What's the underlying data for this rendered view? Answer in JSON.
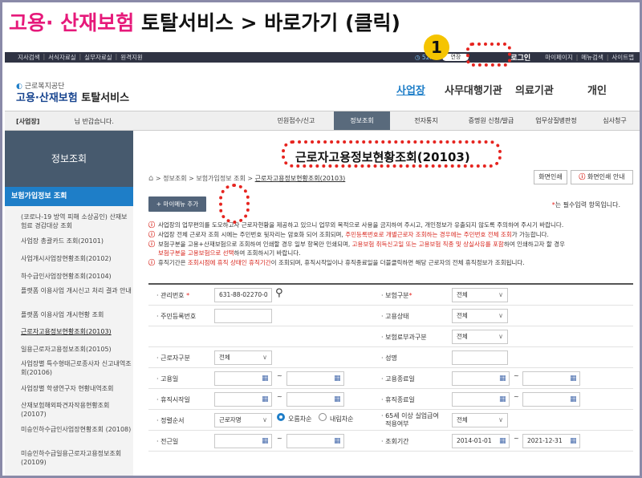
{
  "banner": {
    "part1": "고용·",
    "part2": "산재보험",
    "part3": "토탈서비스 > 바로가기 (클릭)"
  },
  "badge": "1",
  "topbar": {
    "left": [
      "지사검색",
      "서식자료실",
      "실무자료실",
      "원격지원"
    ],
    "timer": "◷ 52:10",
    "ext": "연장",
    "login": "로그인",
    "right": [
      "마이페이지",
      "메뉴검색",
      "사이트맵"
    ]
  },
  "header": {
    "org": "근로복지공단",
    "logo_a": "고용·산재보험",
    "logo_b": "토탈서비스",
    "nav": [
      "사업장",
      "사무대행기관",
      "의료기관",
      "개인"
    ]
  },
  "gnb": {
    "welcome_a": "[사업장]",
    "welcome_b": "님 반갑습니다.",
    "tabs": [
      "민원접수/신고",
      "정보조회",
      "전자통지",
      "증명원 신청/발급",
      "업무상질병판정",
      "심사청구"
    ]
  },
  "sidebar": {
    "title": "정보조회",
    "section": "보험가입정보 조회",
    "items": [
      "(코로나-19 방역 피해 소상공인) 산재보험료 경감대상 조회",
      "사업장 총괄카드 조회(20101)",
      "사업개시사업장현황조회(20102)",
      "하수급인사업장현황조회(20104)",
      "플랫폼 이용사업 개시신고 처리 결과 안내",
      "플랫폼 이용사업 개시현황 조회",
      "근로자고용정보현황조회(20103)",
      "일용근로자고용정보조회(20105)",
      "사업장별 특수형태근로종사자 신고내역조회(20106)",
      "사업장별 학생연구자 현황내역조회",
      "산재보험해외파견자작용현황조회 (20107)",
      "미승인하수급인사업장현황조회 (20108)",
      "미승인하수급일용근로자고용정보조회 (20109)"
    ]
  },
  "main": {
    "title": "근로자고용정보현황조회(20103)",
    "crumb": [
      "정보조회",
      "보험가입정보 조회",
      "근로자고용정보현황조회(20103)"
    ],
    "btn_print": "화면인쇄",
    "btn_guide": "화면인쇄 안내",
    "btn_add": "+ 마이메뉴 추가",
    "req_note_star": "*",
    "req_note": "는 필수입력 항목입니다.",
    "notices": [
      {
        "a": "사업장의 업무편의를 도모하고자 근로자현황을 제공하고 있으니 업무외 목적으로 사용을 금지하여 주시고, 개인정보가 유출되지 않도록 주의하여 주시기 바랍니다.",
        "r": "",
        "b": ""
      },
      {
        "a": "사업장 전체 근로자 조회 시에는 주민번호 뒷자리는 암호화 되어 조회되며, ",
        "r": "주민등록번호로 개별근로자 조회하는 경우에는 주민번호 전체 조회",
        "b": "가 가능합니다."
      },
      {
        "a": "보험구분을 고용+산재보험으로 조회하여 인쇄할 경우 일부 항목만 인쇄되며, ",
        "r": "고용보험 취득신고일 또는 고용보험 직종 및 상실사유를 포함",
        "b": "하여 인쇄하고자 할 경우"
      },
      {
        "a": "",
        "r": "보험구분을 고용보험으로 선택",
        "b": "하여 조회하시기 바랍니다."
      },
      {
        "a": "휴직기간은 ",
        "r": "조회시점에 휴직 상태인 휴직기간",
        "b": "이 조회되며, 휴직시작일이나 휴직종료일을 더블클릭하면 해당 근로자의 전체 휴직정보가 조회됩니다."
      }
    ]
  },
  "form": {
    "mgmt_label": "관리번호",
    "mgmt_value": "631-88-02270-0",
    "ins_label": "보험구분",
    "ins_value": "전체",
    "rrn_label": "주민등록번호",
    "emp_status_label": "고용상태",
    "emp_status_value": "전체",
    "levy_label": "보험료부과구분",
    "levy_value": "전체",
    "worker_type_label": "근로자구분",
    "worker_type_value": "전체",
    "name_label": "성명",
    "hire_label": "고용일",
    "end_label": "고용종료일",
    "leave_start_label": "휴직시작일",
    "leave_end_label": "휴직종료일",
    "sort_label": "정렬순서",
    "sort_value": "근로자명",
    "asc": "오름차순",
    "desc": "내림차순",
    "over65_label_1": "65세 이상 실업급여",
    "over65_label_2": "적용여부",
    "over65_value": "전체",
    "transfer_label": "전근일",
    "period_label": "조회기간",
    "period_from": "2014-01-01",
    "period_to": "2021-12-31",
    "tilde": "~"
  }
}
